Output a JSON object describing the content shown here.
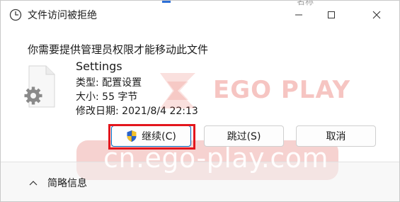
{
  "window": {
    "title": "文件访问被拒绝",
    "obscured_tab_text": "名称",
    "accent_color": "#2d6fd6"
  },
  "dialog": {
    "heading": "你需要提供管理员权限才能移动此文件",
    "file": {
      "name": "Settings",
      "type_line": "类型: 配置设置",
      "size_line": "大小: 55 字节",
      "date_line": "修改日期: 2021/8/4 22:13",
      "icon": "gear-file-icon"
    },
    "buttons": {
      "continue_label": "继续(C)",
      "continue_icon": "uac-shield-icon",
      "skip_label": "跳过(S)",
      "cancel_label": "取消"
    },
    "highlight_color": "#e3161d"
  },
  "footer": {
    "toggle_label": "简略信息",
    "toggle_icon": "chevron-up-icon"
  },
  "watermark": {
    "brand": "EGO PLAY",
    "url": "cn.ego-play.com",
    "color": "#d63228"
  }
}
